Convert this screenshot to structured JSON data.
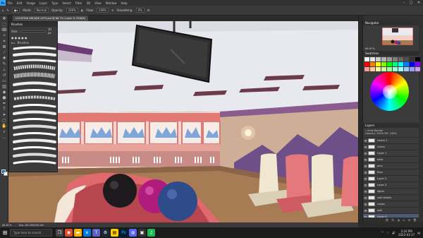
{
  "menubar": {
    "app_icon": "Ps",
    "items": [
      "File",
      "Edit",
      "Image",
      "Layer",
      "Type",
      "Select",
      "Filter",
      "3D",
      "View",
      "Window",
      "Help"
    ]
  },
  "options": {
    "mode_label": "Mode:",
    "mode_value": "Normal",
    "opacity_label": "Opacity:",
    "opacity_value": "100%",
    "flow_label": "Flow:",
    "flow_value": "100%",
    "smoothing_label": "Smoothing:",
    "smoothing_value": "0%"
  },
  "document": {
    "tab_title": "LOCATION ARCADE LEFT.psd @ 66.7% (Layer 9, RGB/8)"
  },
  "brushes_panel": {
    "title": "Brushes",
    "size_label": "Size:",
    "size_value": "30 px",
    "group_label": "Brushes"
  },
  "navigator": {
    "title": "Navigator",
    "zoom": "66.67%"
  },
  "swatches": {
    "title": "Swatches",
    "colors": [
      "#ffffff",
      "#e6e6e6",
      "#cccccc",
      "#b3b3b3",
      "#999999",
      "#808080",
      "#666666",
      "#4d4d4d",
      "#333333",
      "#000000",
      "#ff0000",
      "#ff8000",
      "#ffff00",
      "#80ff00",
      "#00ff00",
      "#00ff80",
      "#00ffff",
      "#0080ff",
      "#0000ff",
      "#8000ff",
      "#ff9999",
      "#ffcc99",
      "#ffff99",
      "#ccff99",
      "#99ff99",
      "#99ffcc",
      "#99ffff",
      "#99ccff",
      "#9999ff",
      "#cc99ff"
    ]
  },
  "layers": {
    "title": "Layers",
    "kind_label": "Kind",
    "blend_mode": "Normal",
    "opacity_label": "Opacity:",
    "opacity_value": "100%",
    "fill_label": "Fill:",
    "fill_value": "100%",
    "items": [
      {
        "name": "Layer 9"
      },
      {
        "name": "chairs 2"
      },
      {
        "name": "chairs"
      },
      {
        "name": "Layer 1"
      },
      {
        "name": "balls"
      },
      {
        "name": "pins"
      },
      {
        "name": "floor"
      },
      {
        "name": "Layer 2"
      },
      {
        "name": "Layer 3"
      },
      {
        "name": "lights"
      },
      {
        "name": "wall details"
      },
      {
        "name": "crown"
      },
      {
        "name": "wall"
      },
      {
        "name": "Layer 8"
      }
    ]
  },
  "statusbar": {
    "zoom": "66.67%",
    "doc_size": "Doc: 80.2M/505.4M"
  },
  "taskbar": {
    "search_placeholder": "Type here to search",
    "time": "2:16 PM",
    "date": "2022-03-17"
  }
}
